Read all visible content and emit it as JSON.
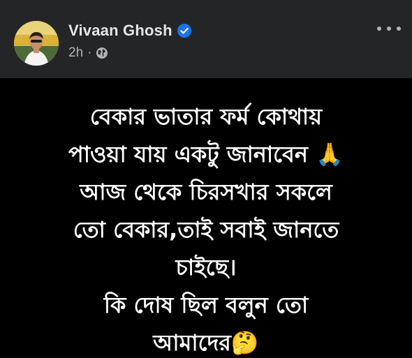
{
  "post": {
    "author": "Vivaan Ghosh",
    "verified_icon": "verified-badge-icon",
    "time": "2h",
    "separator": "·",
    "privacy_icon": "globe-icon",
    "menu_icon": "more-horizontal-icon",
    "text_lines": [
      "বেকার ভাতার ফর্ম কোথায়",
      "পাওয়া যায় একটু জানাবেন 🙏",
      "আজ থেকে চিরসখার সকলে",
      "তো বেকার,তাই সবাই জানতে",
      "চাইছে।",
      "কি দোষ ছিল বলুন তো",
      "আমাদের🤔"
    ]
  },
  "colors": {
    "header_bg": "#242526",
    "body_bg": "#000000",
    "verified_blue": "#1b74e4",
    "name_text": "#e4e6eb",
    "meta_text": "#b0b3b8"
  }
}
